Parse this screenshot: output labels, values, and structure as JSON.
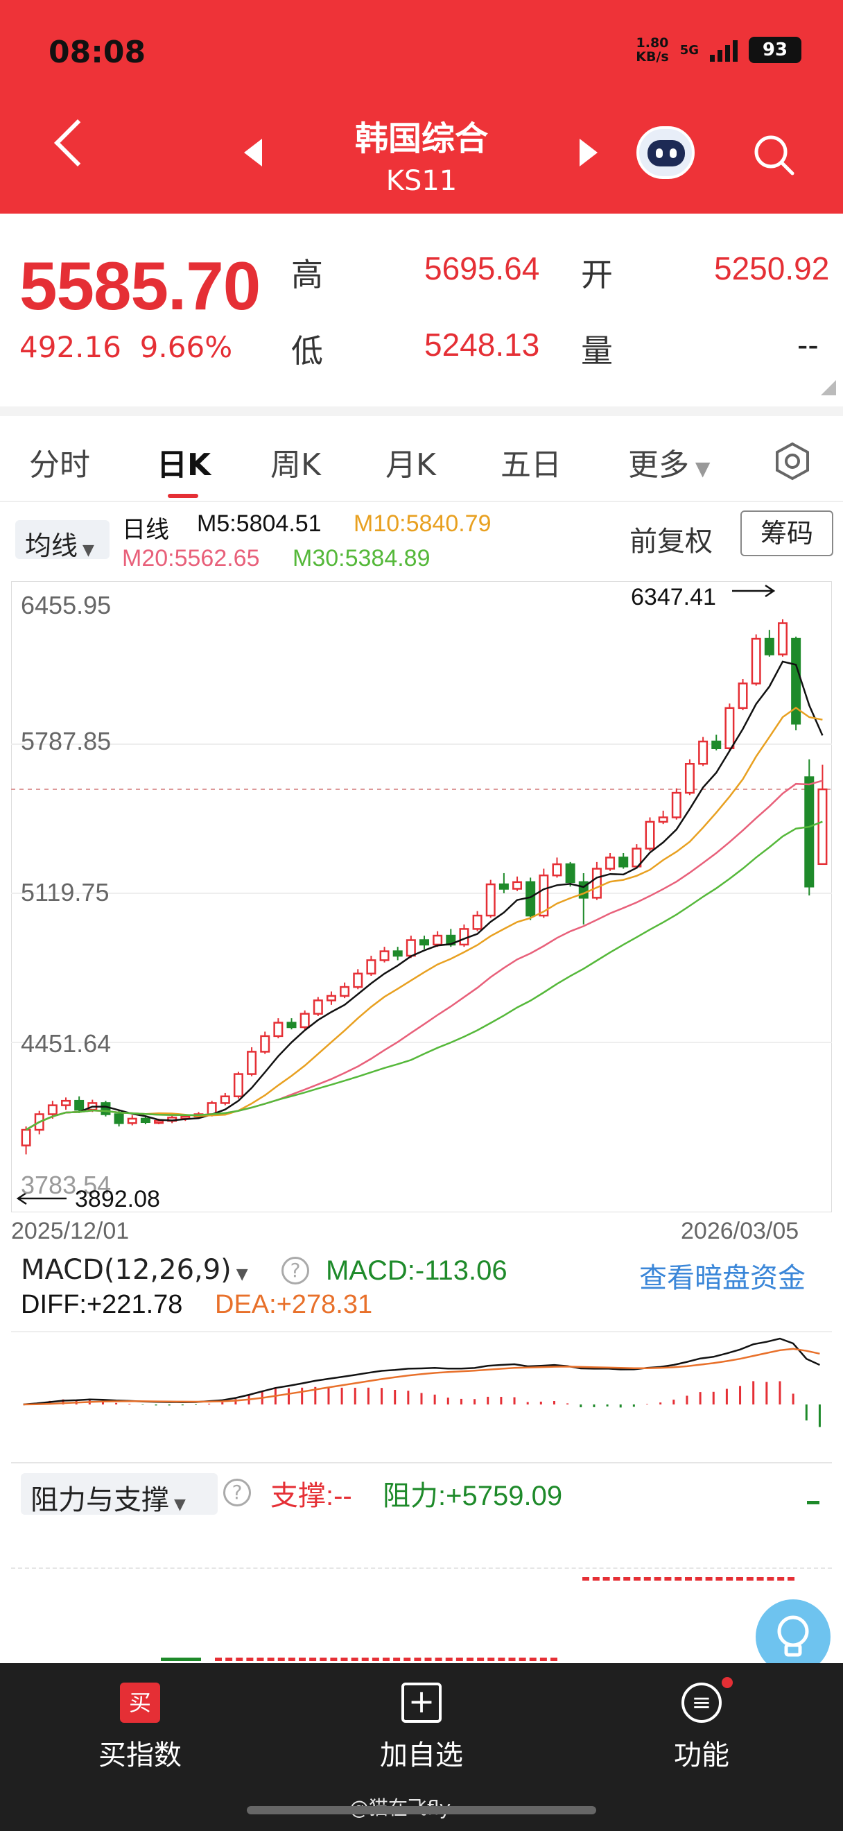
{
  "status_bar": {
    "time": "08:08",
    "net_speed_top": "1.80",
    "net_speed_bottom": "KB/s",
    "net_type": "5G",
    "battery": "93"
  },
  "header": {
    "title": "韩国综合",
    "code": "KS11",
    "icons": [
      "back-icon",
      "prev-triangle-icon",
      "next-triangle-icon",
      "robot-assistant-icon",
      "search-icon"
    ]
  },
  "quote": {
    "price": "5585.70",
    "change": "492.16",
    "change_pct": "9.66%",
    "high_label": "高",
    "high": "5695.64",
    "open_label": "开",
    "open": "5250.92",
    "low_label": "低",
    "low": "5248.13",
    "volume_label": "量",
    "volume": "--"
  },
  "tabs": [
    "分时",
    "日K",
    "周K",
    "月K",
    "五日",
    "更多"
  ],
  "active_tab": "日K",
  "indicators": {
    "ma_button": "均线",
    "period": "日线",
    "m5": "M5:5804.51",
    "m10": "M10:5840.79",
    "m20": "M20:5562.65",
    "m30": "M30:5384.89",
    "adjust": "前复权",
    "chip": "筹码"
  },
  "colors": {
    "header_red": "#ee3338",
    "up": "#e52f35",
    "down": "#1e8a2a",
    "m5": "#111111",
    "m10": "#e8a020",
    "m20": "#e8607a",
    "m30": "#55b83a"
  },
  "chart_data": {
    "type": "candlestick",
    "y_ticks": [
      "6455.95",
      "5787.85",
      "5119.75",
      "4451.64",
      "3783.54"
    ],
    "ylim": [
      3783.54,
      6455.95
    ],
    "x_start": "2025/12/01",
    "x_end": "2026/03/05",
    "max_label": "6347.41",
    "min_label": "3892.08",
    "candles": [
      [
        3990,
        4060,
        3950,
        4075
      ],
      [
        4060,
        4130,
        4040,
        4145
      ],
      [
        4130,
        4170,
        4110,
        4190
      ],
      [
        4170,
        4190,
        4150,
        4205
      ],
      [
        4190,
        4150,
        4135,
        4210
      ],
      [
        4150,
        4180,
        4140,
        4195
      ],
      [
        4180,
        4130,
        4120,
        4190
      ],
      [
        4130,
        4090,
        4075,
        4145
      ],
      [
        4090,
        4110,
        4080,
        4125
      ],
      [
        4110,
        4095,
        4085,
        4120
      ],
      [
        4095,
        4100,
        4085,
        4110
      ],
      [
        4100,
        4115,
        4090,
        4125
      ],
      [
        4115,
        4120,
        4100,
        4130
      ],
      [
        4120,
        4130,
        4110,
        4140
      ],
      [
        4130,
        4180,
        4120,
        4190
      ],
      [
        4180,
        4210,
        4170,
        4225
      ],
      [
        4210,
        4310,
        4200,
        4320
      ],
      [
        4310,
        4410,
        4300,
        4430
      ],
      [
        4410,
        4480,
        4400,
        4500
      ],
      [
        4480,
        4540,
        4470,
        4560
      ],
      [
        4540,
        4520,
        4510,
        4560
      ],
      [
        4520,
        4580,
        4510,
        4595
      ],
      [
        4580,
        4640,
        4570,
        4655
      ],
      [
        4640,
        4660,
        4620,
        4680
      ],
      [
        4660,
        4700,
        4650,
        4720
      ],
      [
        4700,
        4760,
        4690,
        4780
      ],
      [
        4760,
        4820,
        4750,
        4840
      ],
      [
        4820,
        4860,
        4810,
        4880
      ],
      [
        4860,
        4840,
        4820,
        4880
      ],
      [
        4840,
        4910,
        4830,
        4930
      ],
      [
        4910,
        4890,
        4870,
        4930
      ],
      [
        4890,
        4930,
        4880,
        4950
      ],
      [
        4930,
        4890,
        4880,
        4960
      ],
      [
        4890,
        4960,
        4880,
        4980
      ],
      [
        4960,
        5020,
        4950,
        5040
      ],
      [
        5020,
        5160,
        5010,
        5180
      ],
      [
        5160,
        5140,
        5120,
        5210
      ],
      [
        5140,
        5170,
        5130,
        5195
      ],
      [
        5170,
        5020,
        5000,
        5190
      ],
      [
        5020,
        5200,
        5010,
        5230
      ],
      [
        5200,
        5250,
        5190,
        5280
      ],
      [
        5250,
        5170,
        5150,
        5260
      ],
      [
        5170,
        5100,
        4980,
        5210
      ],
      [
        5100,
        5230,
        5090,
        5260
      ],
      [
        5230,
        5280,
        5220,
        5300
      ],
      [
        5280,
        5240,
        5230,
        5300
      ],
      [
        5240,
        5320,
        5230,
        5340
      ],
      [
        5320,
        5440,
        5310,
        5460
      ],
      [
        5440,
        5460,
        5430,
        5490
      ],
      [
        5460,
        5570,
        5450,
        5590
      ],
      [
        5570,
        5700,
        5560,
        5720
      ],
      [
        5700,
        5800,
        5690,
        5820
      ],
      [
        5800,
        5770,
        5760,
        5830
      ],
      [
        5770,
        5950,
        5760,
        5970
      ],
      [
        5950,
        6060,
        5940,
        6080
      ],
      [
        6060,
        6260,
        6050,
        6280
      ],
      [
        6260,
        6190,
        6180,
        6300
      ],
      [
        6190,
        6330,
        6180,
        6347.41
      ],
      [
        6260,
        5880,
        5850,
        6270
      ],
      [
        5640,
        5150,
        5110,
        5720
      ],
      [
        5250.92,
        5585.7,
        5248.13,
        5695.64
      ]
    ]
  },
  "macd": {
    "selector": "MACD(12,26,9)",
    "macd": "MACD:-113.06",
    "diff": "DIFF:+221.78",
    "dea": "DEA:+278.31",
    "dark_pool": "查看暗盘资金"
  },
  "support": {
    "selector": "阻力与支撑",
    "support": "支撑:--",
    "resistance": "阻力:+5759.09"
  },
  "bottom_nav": {
    "buy_index": "买指数",
    "buy_icon": "买",
    "add_watch": "加自选",
    "functions": "功能"
  },
  "watermark_text": "@猫在飞fly"
}
